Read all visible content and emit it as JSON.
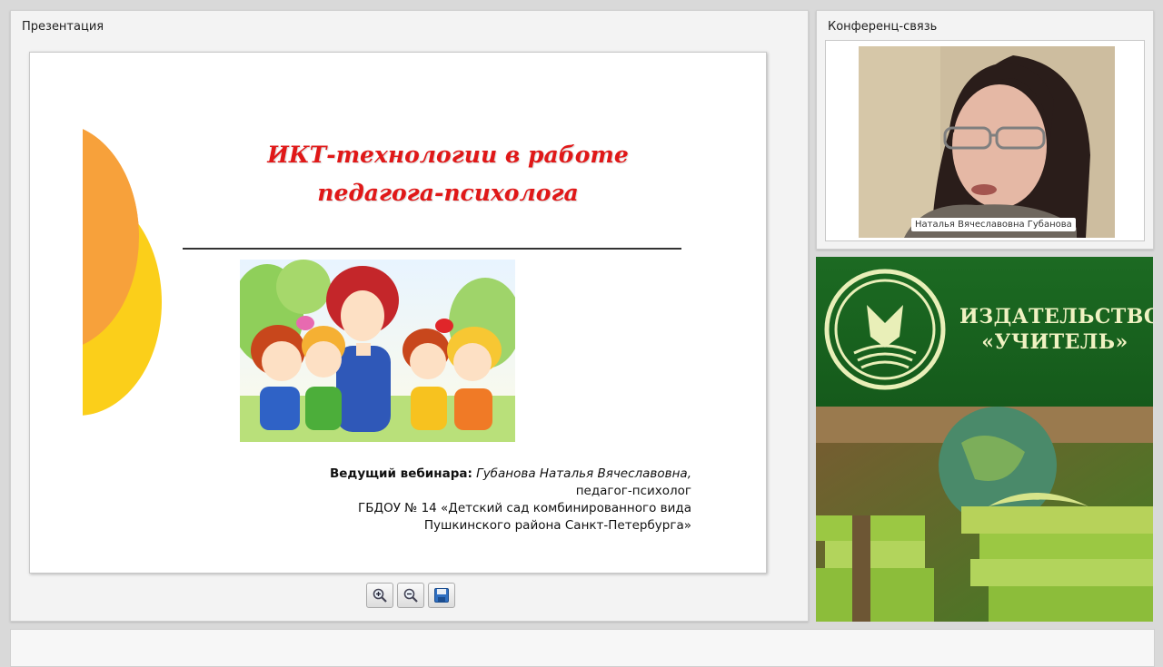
{
  "presentation": {
    "panel_title": "Презентация",
    "slide": {
      "title_line1": "ИКТ-технологии в работе",
      "title_line2": "педагога-психолога",
      "host_label": "Ведущий вебинара:",
      "host_name": "Губанова Наталья Вячеславовна,",
      "host_role": "педагог-психолог",
      "org_line1": "ГБДОУ № 14 «Детский сад комбинированного вида",
      "org_line2": "Пушкинского района Санкт-Петербурга»"
    },
    "toolbar": {
      "zoom_in_icon": "zoom-in-icon",
      "zoom_out_icon": "zoom-out-icon",
      "save_icon": "save-icon"
    }
  },
  "conference": {
    "panel_title": "Конференц-связь",
    "participant_name": "Наталья Вячеславовна Губанова"
  },
  "banner": {
    "line1": "ИЗДАТЕЛЬСТВО",
    "line2": "«УЧИТЕЛЬ»"
  },
  "colors": {
    "title_red": "#e01818",
    "banner_green": "#1c6a22",
    "banner_text": "#f0f2c2",
    "shape_orange": "#f7a13b",
    "shape_yellow": "#fbcf1a"
  }
}
